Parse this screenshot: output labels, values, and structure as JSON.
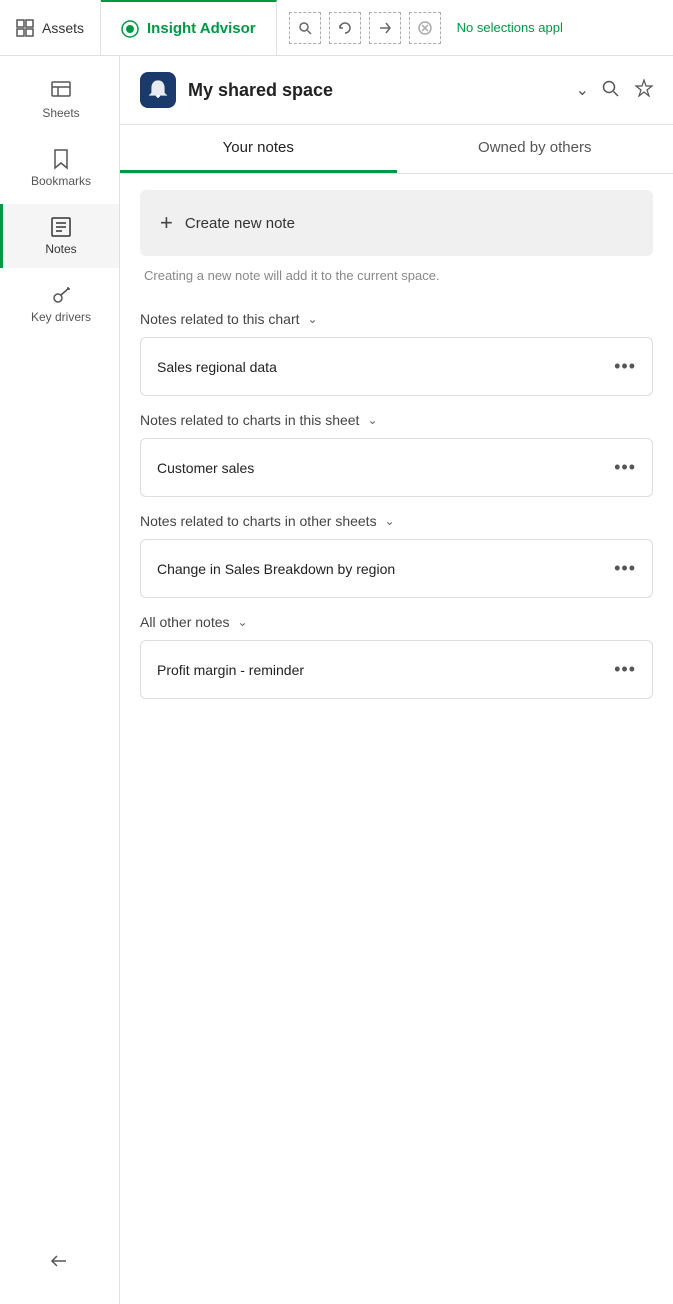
{
  "topbar": {
    "assets_label": "Assets",
    "insight_label": "Insight Advisor",
    "status": "No selections appl",
    "actions": [
      {
        "name": "search-action",
        "icon": "⊕"
      },
      {
        "name": "refresh-action",
        "icon": "↺"
      },
      {
        "name": "share-action",
        "icon": "↗"
      },
      {
        "name": "clear-action",
        "icon": "⊗"
      }
    ]
  },
  "sidebar": {
    "items": [
      {
        "id": "sheets",
        "label": "Sheets",
        "active": false
      },
      {
        "id": "bookmarks",
        "label": "Bookmarks",
        "active": false
      },
      {
        "id": "notes",
        "label": "Notes",
        "active": true
      },
      {
        "id": "key-drivers",
        "label": "Key drivers",
        "active": false
      }
    ],
    "collapse_label": "Collapse"
  },
  "space": {
    "icon": "🔔",
    "name": "My shared space"
  },
  "tabs": [
    {
      "id": "your-notes",
      "label": "Your notes",
      "active": true
    },
    {
      "id": "owned-by-others",
      "label": "Owned by others",
      "active": false
    }
  ],
  "create_note": {
    "label": "Create new note",
    "hint": "Creating a new note will add it to the current space."
  },
  "sections": [
    {
      "id": "related-chart",
      "label": "Notes related to this chart",
      "notes": [
        {
          "id": "note-1",
          "title": "Sales regional data"
        }
      ]
    },
    {
      "id": "related-sheet",
      "label": "Notes related to charts in this sheet",
      "notes": [
        {
          "id": "note-2",
          "title": "Customer sales"
        }
      ]
    },
    {
      "id": "related-other-sheets",
      "label": "Notes related to charts in other sheets",
      "notes": [
        {
          "id": "note-3",
          "title": "Change in Sales Breakdown by region"
        }
      ]
    },
    {
      "id": "all-other",
      "label": "All other notes",
      "notes": [
        {
          "id": "note-4",
          "title": "Profit margin - reminder"
        }
      ]
    }
  ]
}
